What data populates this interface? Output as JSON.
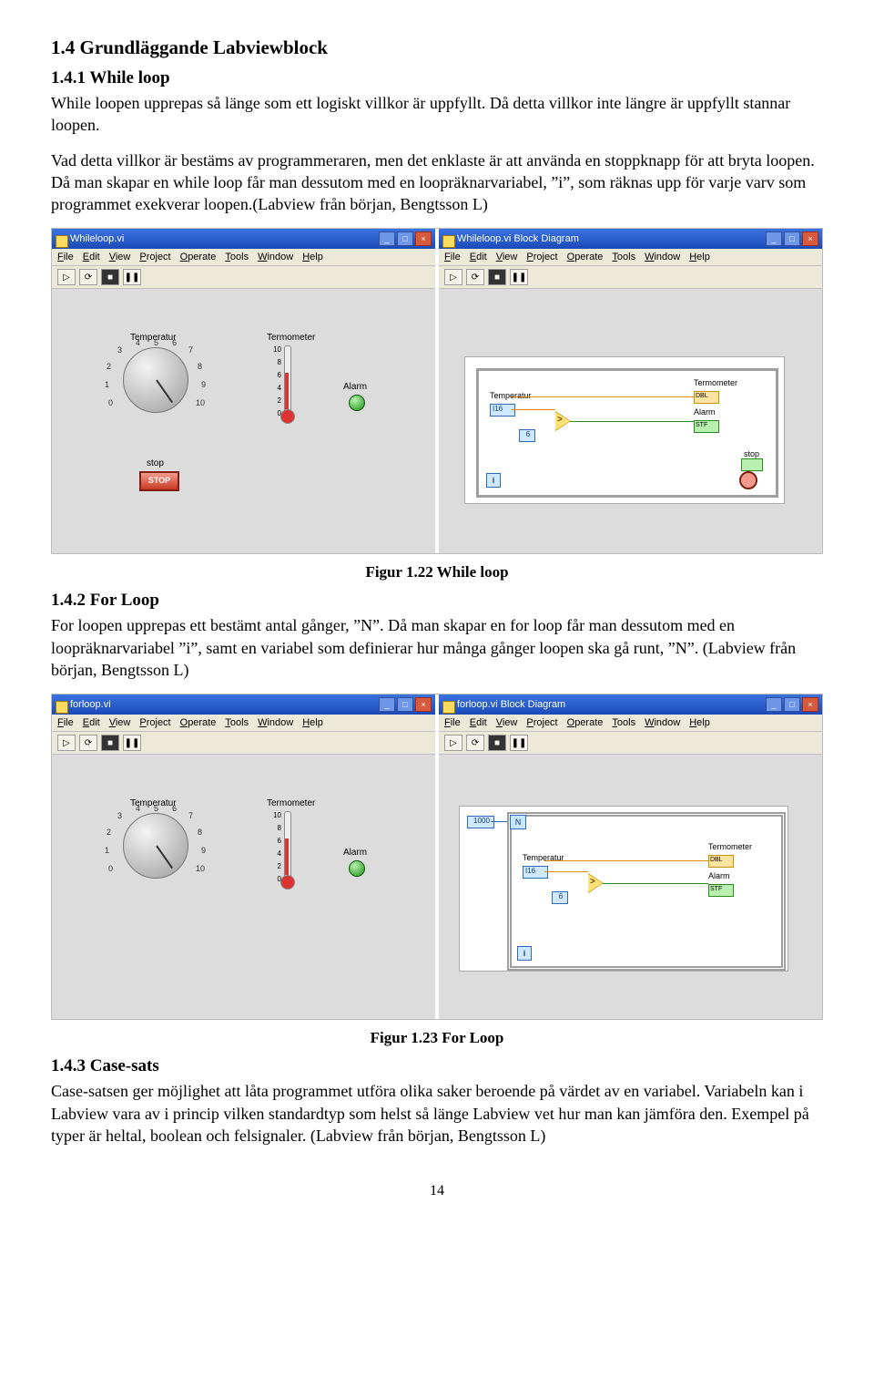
{
  "headings": {
    "h1_4": "1.4 Grundläggande Labviewblock",
    "h1_4_1": "1.4.1 While loop",
    "h1_4_2": "1.4.2 For Loop",
    "h1_4_3": "1.4.3 Case-sats"
  },
  "paragraphs": {
    "p1": "While loopen upprepas så länge som ett logiskt villkor är uppfyllt. Då detta villkor inte längre är uppfyllt stannar loopen.",
    "p2": "Vad detta villkor är bestäms av programmeraren, men det enklaste är att använda en stoppknapp för att bryta loopen. Då man skapar en while loop får man dessutom med en loopräknarvariabel, ”i”, som räknas upp för varje varv som programmet exekverar loopen.(Labview från början, Bengtsson L)",
    "p3": "For loopen upprepas ett bestämt antal gånger, ”N”. Då man skapar en for loop får man dessutom med en loopräknarvariabel ”i”, samt en variabel som definierar hur många gånger loopen ska gå runt, ”N”. (Labview från början, Bengtsson L)",
    "p4": "Case-satsen ger möjlighet att låta programmet utföra olika saker beroende på värdet av en variabel. Variabeln kan i Labview vara av i princip vilken standardtyp som helst så länge Labview vet hur man kan jämföra den. Exempel på typer är heltal, boolean och felsignaler. (Labview från början, Bengtsson L)"
  },
  "captions": {
    "fig22": "Figur 1.22 While loop",
    "fig23": "Figur 1.23 For Loop"
  },
  "page_number": "14",
  "windows": {
    "while_front": {
      "title": "Whileloop.vi"
    },
    "while_block": {
      "title": "Whileloop.vi Block Diagram"
    },
    "for_front": {
      "title": "forloop.vi"
    },
    "for_block": {
      "title": "forloop.vi Block Diagram"
    }
  },
  "menu": {
    "file": "File",
    "edit": "Edit",
    "view": "View",
    "project": "Project",
    "operate": "Operate",
    "tools": "Tools",
    "window": "Window",
    "help": "Help"
  },
  "front_panel": {
    "temperatur": "Temperatur",
    "termometer": "Termometer",
    "alarm": "Alarm",
    "stop": "stop",
    "stop_btn": "STOP",
    "knob_ticks": [
      "0",
      "1",
      "2",
      "3",
      "4",
      "5",
      "6",
      "7",
      "8",
      "9",
      "10"
    ],
    "thermo_ticks": [
      "10",
      "8",
      "6",
      "4",
      "2",
      "0"
    ]
  },
  "block_diagram": {
    "temperatur": "Temperatur",
    "termometer": "Termometer",
    "alarm": "Alarm",
    "stop": "stop",
    "i": "i",
    "n": "N",
    "n_value": "1000",
    "dbl": "DBL",
    "stf": "STF",
    "i16": "I16"
  },
  "toolbar": {
    "run": "▷",
    "run_cont": "⟳",
    "stop": "■",
    "pause": "❚❚"
  },
  "winbtns": {
    "min": "_",
    "max": "□",
    "close": "×"
  }
}
